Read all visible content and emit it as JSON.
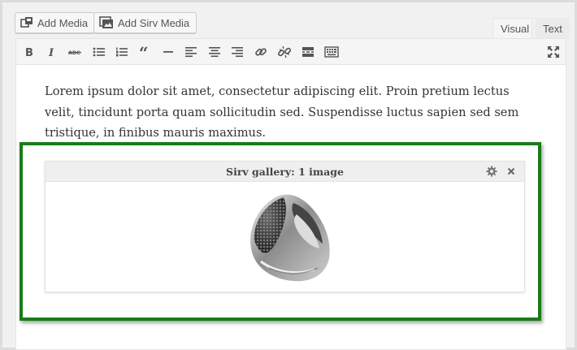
{
  "media_buttons": {
    "add_media": "Add Media",
    "add_sirv_media": "Add Sirv Media"
  },
  "editor_tabs": {
    "visual": "Visual",
    "text": "Text"
  },
  "toolbar": {
    "buttons": [
      "bold-icon",
      "italic-icon",
      "strikethrough-icon",
      "bullet-list-icon",
      "numbered-list-icon",
      "blockquote-icon",
      "horizontal-rule-icon",
      "align-left-icon",
      "align-center-icon",
      "align-right-icon",
      "link-icon",
      "unlink-icon",
      "read-more-icon",
      "toolbar-toggle-icon",
      "fullscreen-icon"
    ]
  },
  "content": {
    "paragraph": "Lorem ipsum dolor sit amet, consectetur adipiscing elit. Proin pretium lectus velit, tincidunt porta quam sollicitudin sed. Suspendisse luctus sapien sed sem tristique, in finibus mauris maximus."
  },
  "gallery": {
    "title": "Sirv gallery: 1 image",
    "settings_icon": "gear-icon",
    "remove_icon": "close-icon",
    "image": "ring-image"
  },
  "colors": {
    "highlight_border": "#187c18",
    "toolbar_bg": "#f5f5f5",
    "icon": "#555555"
  }
}
